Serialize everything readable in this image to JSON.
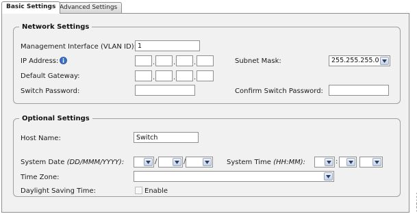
{
  "tabs": [
    {
      "label": "Basic Settings"
    },
    {
      "label": "Advanced Settings"
    }
  ],
  "network": {
    "legend": "Network Settings",
    "mgmt_label": "Management Interface (VLAN ID):",
    "mgmt_value": "1",
    "ip_label": "IP Address:",
    "ip_octets": [
      "",
      "",
      "",
      ""
    ],
    "subnet_label": "Subnet Mask:",
    "subnet_value": "255.255.255.0",
    "gateway_label": "Default Gateway:",
    "gateway_octets": [
      "",
      "",
      "",
      ""
    ],
    "pw_label": "Switch Password:",
    "pw_value": "",
    "confirm_label": "Confirm Switch Password:",
    "confirm_value": "",
    "octet_separator": "."
  },
  "optional": {
    "legend": "Optional Settings",
    "host_label": "Host Name:",
    "host_value": "Switch",
    "date_label": "System Date",
    "date_format": "(DD/MMM/YYYY):",
    "date_separator": "/",
    "time_label": "System Time",
    "time_format": "(HH:MM):",
    "time_separator": ":",
    "tz_label": "Time Zone:",
    "tz_value": "",
    "dst_label": "Daylight Saving Time:",
    "dst_checkbox_label": "Enable",
    "dst_checked": false
  },
  "figure_id": "157931",
  "colors": {
    "panel_bg": "#f1f1f1",
    "border": "#9e9e9e",
    "info_icon": "#3a6fc4"
  }
}
